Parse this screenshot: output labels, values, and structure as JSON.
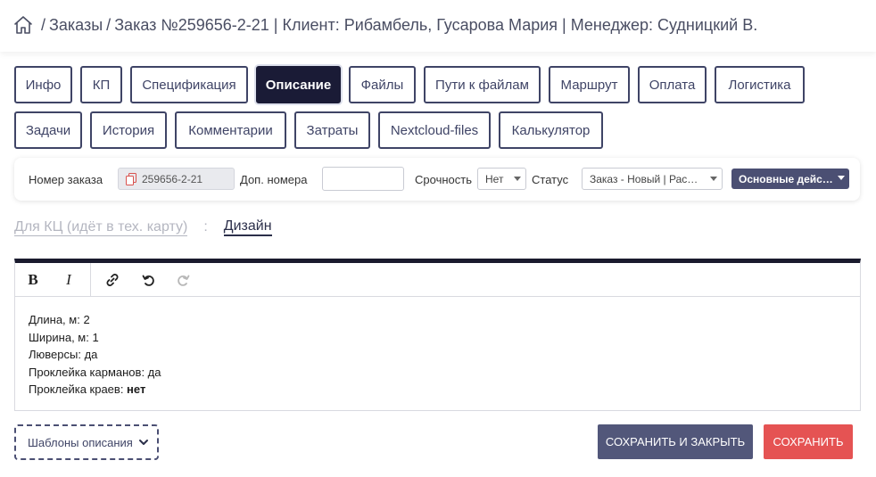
{
  "breadcrumb": {
    "icon": "home-icon",
    "sep": "/",
    "items": [
      "Заказы",
      "Заказ №259656-2-21 | Клиент: Рибамбель, Гусарова Мария | Менеджер: Судницкий В."
    ]
  },
  "tabs_row1": [
    "Инфо",
    "КП",
    "Спецификация",
    "Описание",
    "Файлы",
    "Пути к файлам",
    "Маршрут",
    "Оплата",
    "Логистика"
  ],
  "tabs_row2": [
    "Задачи",
    "История",
    "Комментарии",
    "Затраты",
    "Nextcloud-files",
    "Калькулятор"
  ],
  "active_tab": "Описание",
  "filters": {
    "order_number_label": "Номер заказа",
    "order_number_value": "259656-2-21",
    "copy_icon": "copy-icon",
    "dop_label": "Доп. номера",
    "dop_value": "",
    "urgency_label": "Срочность",
    "urgency_value": "Нет",
    "status_label": "Статус",
    "status_value": "Заказ - Новый | Рас…",
    "actions_label": "Основные дейс…"
  },
  "subtabs": {
    "inactive": "Для КЦ (идёт в тех. карту)",
    "separator": ":",
    "active": "Дизайн"
  },
  "editor": {
    "toolbar": {
      "bold": "B",
      "italic": "I",
      "link_icon": "link-icon",
      "undo_icon": "undo-icon",
      "redo_icon": "redo-icon"
    },
    "lines": [
      {
        "text": "Длина, м: 2",
        "bold": ""
      },
      {
        "text": "Ширина, м: 1",
        "bold": ""
      },
      {
        "text": "Люверсы: да",
        "bold": ""
      },
      {
        "text": "Проклейка карманов: да",
        "bold": ""
      },
      {
        "text": "Проклейка краев: ",
        "bold": "нет"
      }
    ]
  },
  "footer": {
    "templates_label": "Шаблоны описания",
    "save_close_label": "СОХРАНИТЬ И ЗАКРЫТЬ",
    "save_label": "СОХРАНИТЬ"
  },
  "colors": {
    "active_tab_bg": "#1a1b36",
    "primary_button": "#52577a",
    "danger_button": "#e55353"
  }
}
